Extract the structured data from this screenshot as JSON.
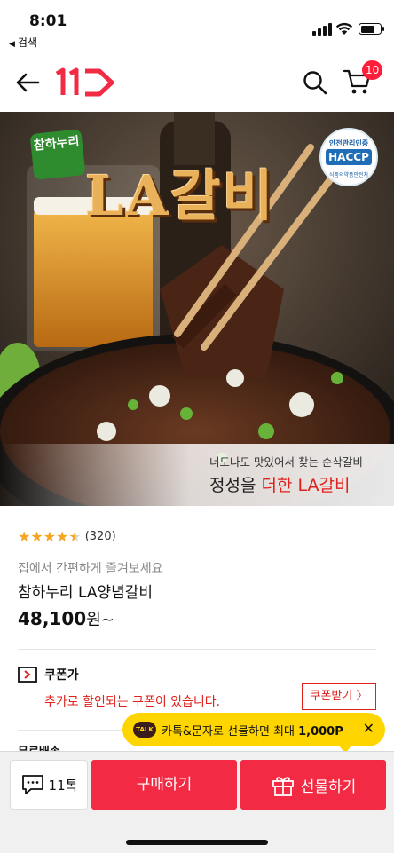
{
  "status_bar": {
    "time": "8:01",
    "back_app": "검색"
  },
  "header": {
    "logo_text": "11",
    "cart_count": "10"
  },
  "hero": {
    "brand_badge": "참하누리",
    "title": "LA갈비",
    "haccp_top": "안전관리인증",
    "haccp_mark": "HACCP",
    "haccp_bottom": "식품의약품안전처",
    "copy_line1": "너도나도 맛있어서 찾는 순삭갈비",
    "copy_line2_a": "정성을 ",
    "copy_line2_b": "더한 LA갈비"
  },
  "product": {
    "stars": "★★★★",
    "rating_count": "(320)",
    "subtitle": "집에서 간편하게 즐겨보세요",
    "name": "참하누리 LA양념갈비",
    "price": "48,100",
    "price_unit": "원~"
  },
  "coupon": {
    "title": "쿠폰가",
    "desc": "추가로 할인되는 쿠폰이 있습니다.",
    "button": "쿠폰받기"
  },
  "delivery_peek": "무료배송",
  "tooltip": {
    "badge": "TALK",
    "text": "카톡&문자로 선물하면 최대 ",
    "amount": "1,000P"
  },
  "bottom_bar": {
    "talk_label": "11톡",
    "buy_label": "구매하기",
    "gift_label": "선물하기"
  },
  "colors": {
    "brand_red": "#f32a44",
    "coupon_red": "#e0201b",
    "star": "#f5a623",
    "tooltip_yellow": "#ffd500"
  }
}
